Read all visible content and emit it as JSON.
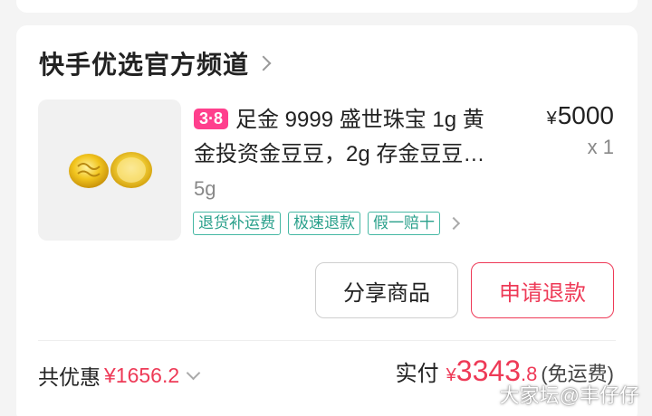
{
  "shop": {
    "name": "快手优选官方频道"
  },
  "product": {
    "badge": "3·8",
    "title_line1": "足金 9999 盛世珠宝 1g 黄",
    "title_line2": "金投资金豆豆，2g 存金豆豆…",
    "spec": "5g",
    "price": "5000",
    "currency": "¥",
    "qty": "x 1",
    "tags": [
      "退货补运费",
      "极速退款",
      "假一赔十"
    ]
  },
  "actions": {
    "share_label": "分享商品",
    "refund_label": "申请退款"
  },
  "summary": {
    "discount_label": "共优惠",
    "discount_amount": "¥1656.2",
    "paid_label": "实付",
    "paid_currency": "¥",
    "paid_int": "3343",
    "paid_dec": ".8",
    "shipping_note": "(免运费)"
  },
  "watermark": "大家坛@丰仔仔",
  "colors": {
    "accent_red": "#ee3a57",
    "tag_green": "#2aa08b",
    "badge_pink": "#ff3f8d"
  }
}
